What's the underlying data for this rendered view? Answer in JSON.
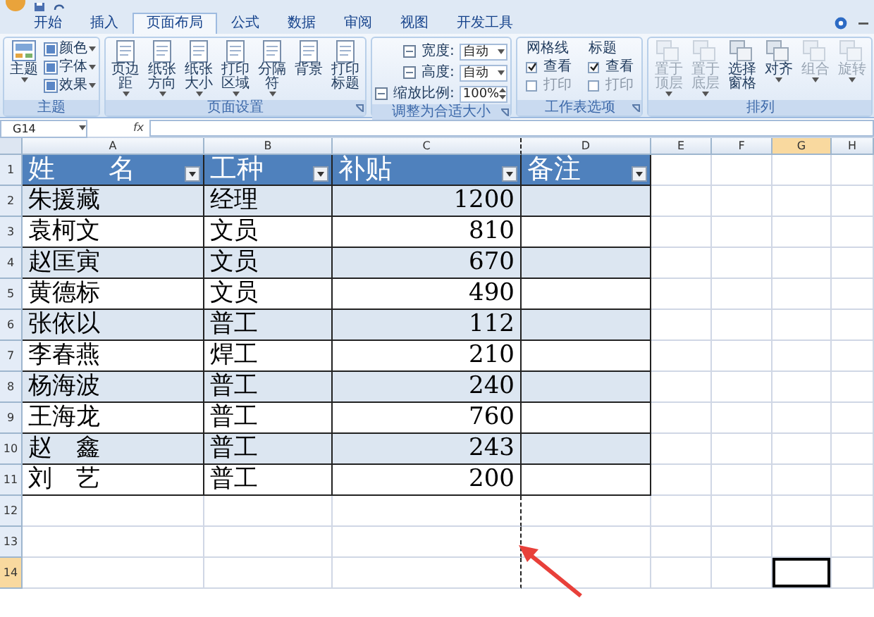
{
  "tabs": [
    {
      "label": "开始",
      "selected": false
    },
    {
      "label": "插入",
      "selected": false
    },
    {
      "label": "页面布局",
      "selected": true
    },
    {
      "label": "公式",
      "selected": false
    },
    {
      "label": "数据",
      "selected": false
    },
    {
      "label": "审阅",
      "selected": false
    },
    {
      "label": "视图",
      "selected": false
    },
    {
      "label": "开发工具",
      "selected": false
    }
  ],
  "ribbon_groups": [
    {
      "kind": "theme",
      "title": "主题",
      "launcher": false,
      "items": [
        {
          "kind": "large",
          "label": "主题",
          "menu": true,
          "disabled": false
        },
        {
          "kind": "small",
          "label": "颜色",
          "menu": true,
          "disabled": false
        },
        {
          "kind": "small",
          "label": "字体",
          "menu": true,
          "disabled": false
        },
        {
          "kind": "small",
          "label": "效果",
          "menu": true,
          "disabled": false
        }
      ]
    },
    {
      "kind": "page_setup",
      "title": "页面设置",
      "launcher": true,
      "items": [
        {
          "kind": "large",
          "label": "页边距",
          "menu": true,
          "disabled": false
        },
        {
          "kind": "large",
          "label": "纸张方向",
          "menu": true,
          "disabled": false
        },
        {
          "kind": "large",
          "label": "纸张大小",
          "menu": true,
          "disabled": false
        },
        {
          "kind": "large",
          "label": "打印区域",
          "menu": true,
          "disabled": false
        },
        {
          "kind": "large",
          "label": "分隔符",
          "menu": true,
          "disabled": false
        },
        {
          "kind": "large",
          "label": "背景",
          "menu": false,
          "disabled": false
        },
        {
          "kind": "large",
          "label": "打印标题",
          "menu": false,
          "disabled": false
        }
      ]
    },
    {
      "kind": "scale",
      "title": "调整为合适大小",
      "launcher": true,
      "items": [
        {
          "kind": "dropdown",
          "label": "宽度:",
          "value": "自动"
        },
        {
          "kind": "dropdown",
          "label": "高度:",
          "value": "自动"
        },
        {
          "kind": "spinner",
          "label": "缩放比例:",
          "value": "100%"
        }
      ]
    },
    {
      "kind": "sheet_options",
      "title": "工作表选项",
      "launcher": true,
      "items": [
        {
          "kind": "options",
          "label": "网格线",
          "options": [
            {
              "label": "查看",
              "checked": true
            },
            {
              "label": "打印",
              "checked": false
            }
          ]
        },
        {
          "kind": "options",
          "label": "标题",
          "options": [
            {
              "label": "查看",
              "checked": true
            },
            {
              "label": "打印",
              "checked": false
            }
          ]
        }
      ]
    },
    {
      "kind": "arrange",
      "title": "排列",
      "launcher": false,
      "items": [
        {
          "kind": "large",
          "label": "置于顶层",
          "menu": true,
          "disabled": true
        },
        {
          "kind": "large",
          "label": "置于底层",
          "menu": true,
          "disabled": true
        },
        {
          "kind": "large",
          "label": "选择窗格",
          "menu": false,
          "disabled": false
        },
        {
          "kind": "large",
          "label": "对齐",
          "menu": true,
          "disabled": false
        },
        {
          "kind": "large",
          "label": "组合",
          "menu": true,
          "disabled": true
        },
        {
          "kind": "large",
          "label": "旋转",
          "menu": true,
          "disabled": true
        }
      ]
    }
  ],
  "formula_bar": {
    "name_box": "G14",
    "function_label": "fx"
  },
  "sheet": {
    "columns": [
      {
        "letter": "A",
        "selected": false
      },
      {
        "letter": "B",
        "selected": false
      },
      {
        "letter": "C",
        "selected": false
      },
      {
        "letter": "D",
        "selected": false
      },
      {
        "letter": "E",
        "selected": false
      },
      {
        "letter": "F",
        "selected": false
      },
      {
        "letter": "G",
        "selected": true
      },
      {
        "letter": "H",
        "selected": false
      }
    ],
    "rows": [
      {
        "number": "1",
        "kind": "header",
        "selected": false,
        "cells": [
          "姓　　名",
          "工种",
          "补贴",
          "备注"
        ]
      },
      {
        "number": "2",
        "kind": "data",
        "selected": false,
        "cells": [
          "朱援藏",
          "经理",
          "1200"
        ]
      },
      {
        "number": "3",
        "kind": "data",
        "selected": false,
        "cells": [
          "袁柯文",
          "文员",
          "810"
        ]
      },
      {
        "number": "4",
        "kind": "data",
        "selected": false,
        "cells": [
          "赵匡寅",
          "文员",
          "670"
        ]
      },
      {
        "number": "5",
        "kind": "data",
        "selected": false,
        "cells": [
          "黄德标",
          "文员",
          "490"
        ]
      },
      {
        "number": "6",
        "kind": "data",
        "selected": false,
        "cells": [
          "张依以",
          "普工",
          "112"
        ]
      },
      {
        "number": "7",
        "kind": "data",
        "selected": false,
        "cells": [
          "李春燕",
          "焊工",
          "210"
        ]
      },
      {
        "number": "8",
        "kind": "data",
        "selected": false,
        "cells": [
          "杨海波",
          "普工",
          "240"
        ]
      },
      {
        "number": "9",
        "kind": "data",
        "selected": false,
        "cells": [
          "王海龙",
          "普工",
          "760"
        ]
      },
      {
        "number": "10",
        "kind": "data",
        "selected": false,
        "cells": [
          "赵　鑫",
          "普工",
          "243"
        ]
      },
      {
        "number": "11",
        "kind": "data",
        "selected": false,
        "cells": [
          "刘　艺",
          "普工",
          "200"
        ]
      },
      {
        "number": "12",
        "kind": "empty",
        "selected": false
      },
      {
        "number": "13",
        "kind": "empty",
        "selected": false
      },
      {
        "number": "14",
        "kind": "empty",
        "selected": true
      }
    ]
  }
}
